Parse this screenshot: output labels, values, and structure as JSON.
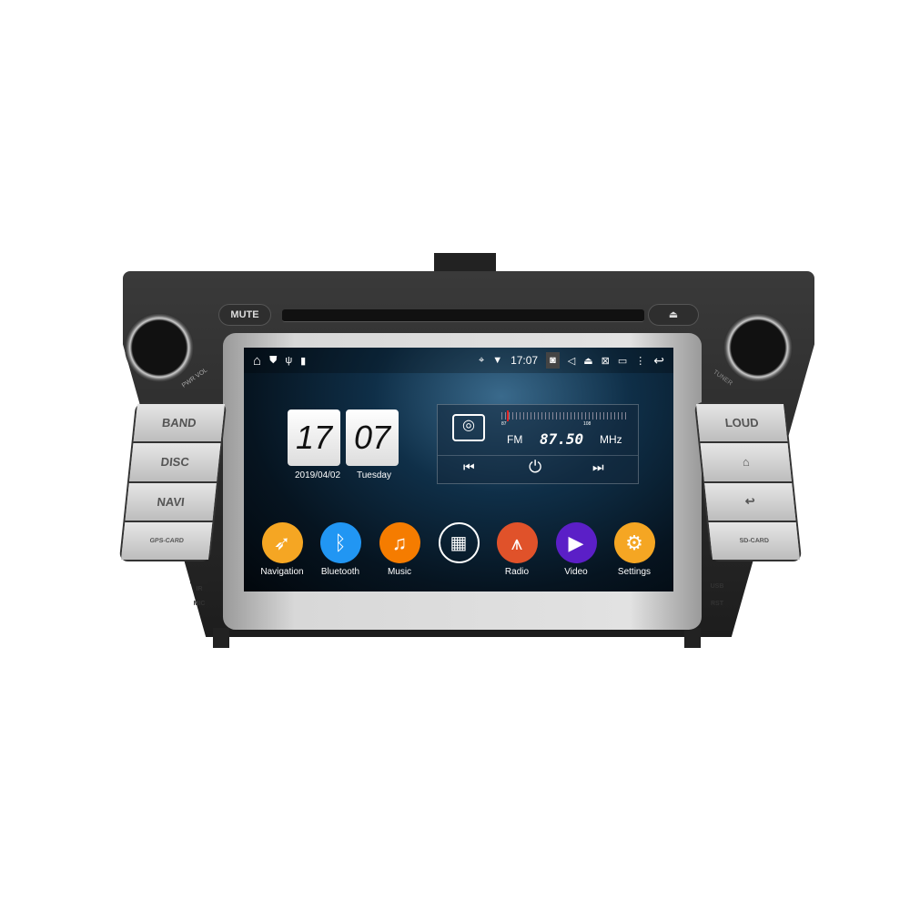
{
  "bezel": {
    "mute": "MUTE",
    "eject": "⏏",
    "left_knob_label": "PWR VOL",
    "right_knob_label": "TUNER",
    "left_buttons": [
      "BAND",
      "DISC",
      "NAVI",
      "GPS-CARD"
    ],
    "right_buttons": [
      "LOUD",
      "⌂",
      "↩",
      "SD-CARD"
    ],
    "ir": "IR",
    "mic": "MIC",
    "usb": "USB",
    "rst": "RST"
  },
  "status_bar": {
    "time": "17:07",
    "icons": [
      "home-icon",
      "shield-icon",
      "usb-icon",
      "sd-icon",
      "location-icon",
      "wifi-icon",
      "camera-icon",
      "volume-icon",
      "eject-icon",
      "screen-off-icon",
      "window-icon",
      "menu-icon",
      "back-icon"
    ]
  },
  "clock": {
    "hour": "17",
    "minute": "07",
    "date": "2019/04/02",
    "day": "Tuesday"
  },
  "radio": {
    "band": "FM",
    "frequency": "87.50",
    "unit": "MHz",
    "scale_min": "87",
    "scale_max": "108"
  },
  "apps": [
    {
      "label": "Navigation",
      "color": "#f5a623",
      "icon": "compass"
    },
    {
      "label": "Bluetooth",
      "color": "#2196f3",
      "icon": "bluetooth"
    },
    {
      "label": "Music",
      "color": "#f57c00",
      "icon": "music"
    },
    {
      "label": "",
      "color": "transparent",
      "icon": "apps-grid"
    },
    {
      "label": "Radio",
      "color": "#e0522a",
      "icon": "antenna"
    },
    {
      "label": "Video",
      "color": "#5b1fc7",
      "icon": "play"
    },
    {
      "label": "Settings",
      "color": "#f5a623",
      "icon": "gear"
    }
  ]
}
